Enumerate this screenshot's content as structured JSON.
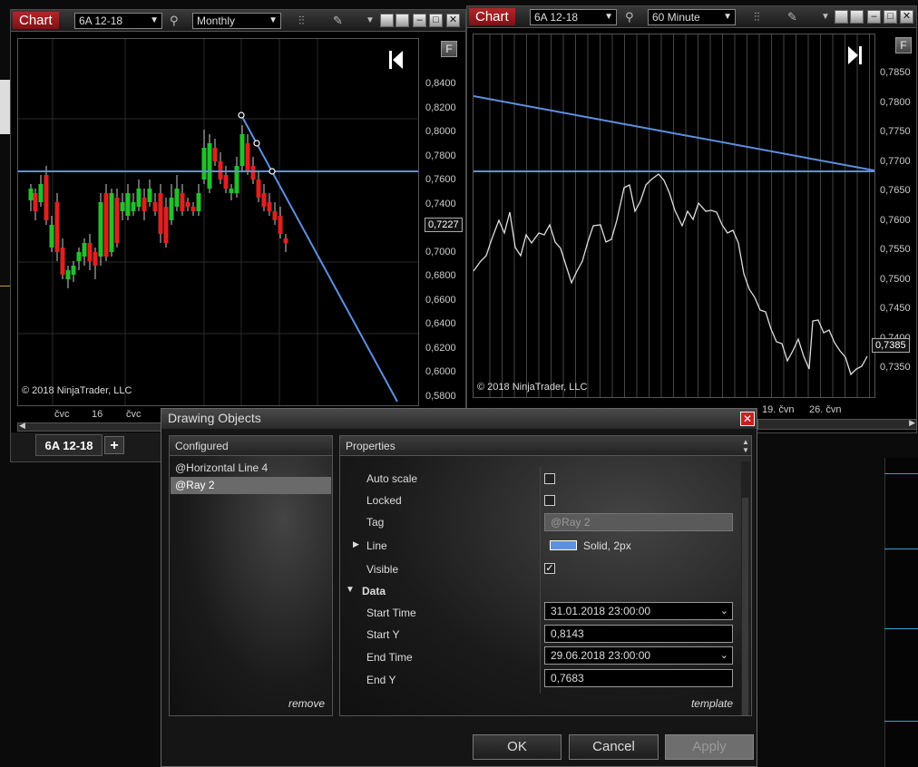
{
  "left_chart": {
    "chart_label": "Chart",
    "instrument": "6A 12-18",
    "interval": "Monthly",
    "y_ticks": [
      "0,8400",
      "0,8200",
      "0,8000",
      "0,7800",
      "0,7600",
      "0,7400",
      "0,7200",
      "0,7000",
      "0,6800",
      "0,6600",
      "0,6400",
      "0,6200",
      "0,6000",
      "0,5800"
    ],
    "x_ticks": [
      "čvc",
      "16",
      "čvc"
    ],
    "price_tag": "0,7227",
    "copyright": "© 2018 NinjaTrader, LLC",
    "f_button": "F",
    "tab_label": "6A 12-18",
    "add_tab": "+"
  },
  "right_chart": {
    "chart_label": "Chart",
    "instrument": "6A 12-18",
    "interval": "60 Minute",
    "y_ticks": [
      "0,7850",
      "0,7800",
      "0,7750",
      "0,7700",
      "0,7650",
      "0,7600",
      "0,7550",
      "0,7500",
      "0,7450",
      "0,7400",
      "0,7350"
    ],
    "x_ticks": [
      "19. čvn",
      "26. čvn"
    ],
    "price_tag": "0,7385",
    "copyright": "© 2018 NinjaTrader, LLC",
    "f_button": "F"
  },
  "dialog": {
    "title": "Drawing Objects",
    "configured_header": "Configured",
    "items": [
      "@Horizontal Line 4",
      "@Ray 2"
    ],
    "remove": "remove",
    "properties_header": "Properties",
    "auto_scale_label": "Auto scale",
    "locked_label": "Locked",
    "tag_label": "Tag",
    "tag_value": "@Ray 2",
    "line_label": "Line",
    "line_value": "Solid, 2px",
    "visible_label": "Visible",
    "data_section": "Data",
    "start_time_label": "Start Time",
    "start_time": "31.01.2018 23:00:00",
    "start_y_label": "Start Y",
    "start_y": "0,8143",
    "end_time_label": "End Time",
    "end_time": "29.06.2018 23:00:00",
    "end_y_label": "End Y",
    "end_y": "0,7683",
    "template": "template",
    "ok": "OK",
    "cancel": "Cancel",
    "apply": "Apply"
  },
  "colors": {
    "accent_red": "#b3262a",
    "line_blue": "#5f8fe0",
    "up_candle": "#22c02a",
    "down_candle": "#e02020"
  },
  "icons": [
    "search-icon",
    "bar-style-icon",
    "pencil-icon",
    "dropdown-arrow-icon",
    "minimize-icon",
    "maximize-icon",
    "close-icon",
    "jump-to-end-icon"
  ]
}
